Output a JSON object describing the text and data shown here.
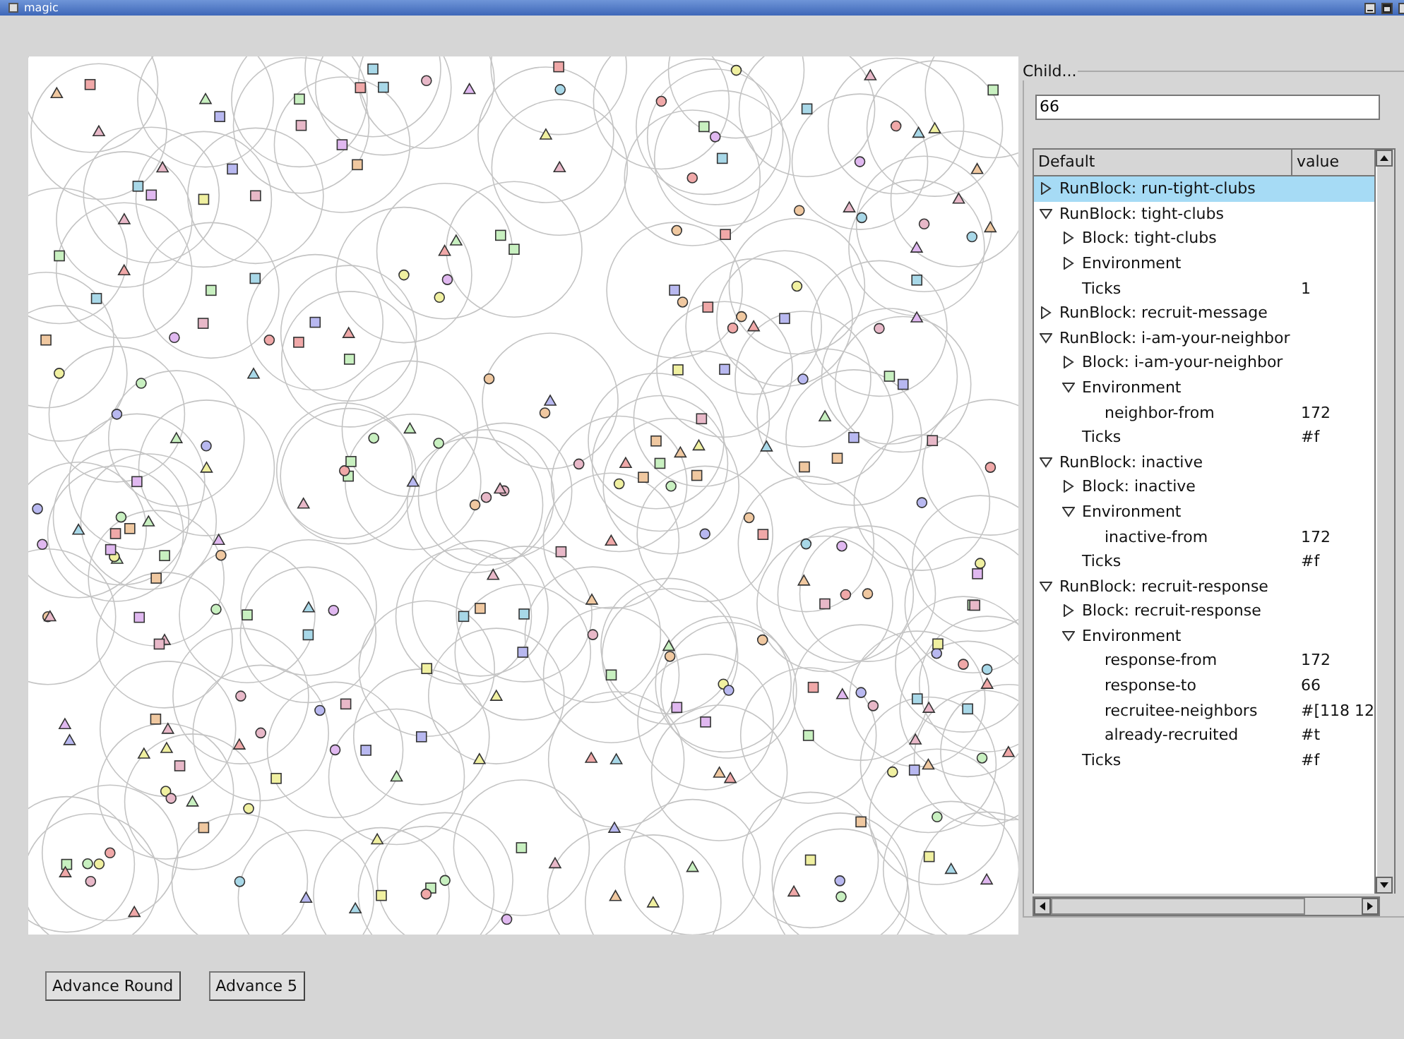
{
  "window": {
    "title": "magic"
  },
  "child_panel": {
    "legend": "Child...",
    "field_value": "66"
  },
  "tree": {
    "columns": [
      "Default",
      "value"
    ],
    "items": [
      {
        "label": "RunBlock: run-tight-clubs",
        "expanded": false,
        "selected": true
      },
      {
        "label": "RunBlock: tight-clubs",
        "expanded": true,
        "selected": false,
        "children": [
          {
            "label": "Block: tight-clubs",
            "expanded": false,
            "selected": false
          },
          {
            "label": "Environment",
            "expanded": false,
            "selected": false
          },
          {
            "label": "Ticks",
            "value": "1",
            "selected": false
          }
        ]
      },
      {
        "label": "RunBlock: recruit-message",
        "expanded": false,
        "selected": false
      },
      {
        "label": "RunBlock: i-am-your-neighbor",
        "expanded": true,
        "selected": false,
        "children": [
          {
            "label": "Block: i-am-your-neighbor",
            "expanded": false,
            "selected": false
          },
          {
            "label": "Environment",
            "expanded": true,
            "selected": false,
            "children": [
              {
                "label": "neighbor-from",
                "value": "172",
                "selected": false
              }
            ]
          },
          {
            "label": "Ticks",
            "value": "#f",
            "selected": false
          }
        ]
      },
      {
        "label": "RunBlock: inactive",
        "expanded": true,
        "selected": false,
        "children": [
          {
            "label": "Block: inactive",
            "expanded": false,
            "selected": false
          },
          {
            "label": "Environment",
            "expanded": true,
            "selected": false,
            "children": [
              {
                "label": "inactive-from",
                "value": "172",
                "selected": false
              }
            ]
          },
          {
            "label": "Ticks",
            "value": "#f",
            "selected": false
          }
        ]
      },
      {
        "label": "RunBlock: recruit-response",
        "expanded": true,
        "selected": false,
        "children": [
          {
            "label": "Block: recruit-response",
            "expanded": false,
            "selected": false
          },
          {
            "label": "Environment",
            "expanded": true,
            "selected": false,
            "children": [
              {
                "label": "response-from",
                "value": "172",
                "selected": false
              },
              {
                "label": "response-to",
                "value": "66",
                "selected": false
              },
              {
                "label": "recruitee-neighbors",
                "value": "#[118 12",
                "selected": false
              },
              {
                "label": "already-recruited",
                "value": "#t",
                "selected": false
              }
            ]
          },
          {
            "label": "Ticks",
            "value": "#f",
            "selected": false
          }
        ]
      }
    ]
  },
  "buttons": [
    "Advance Round",
    "Advance 5"
  ]
}
